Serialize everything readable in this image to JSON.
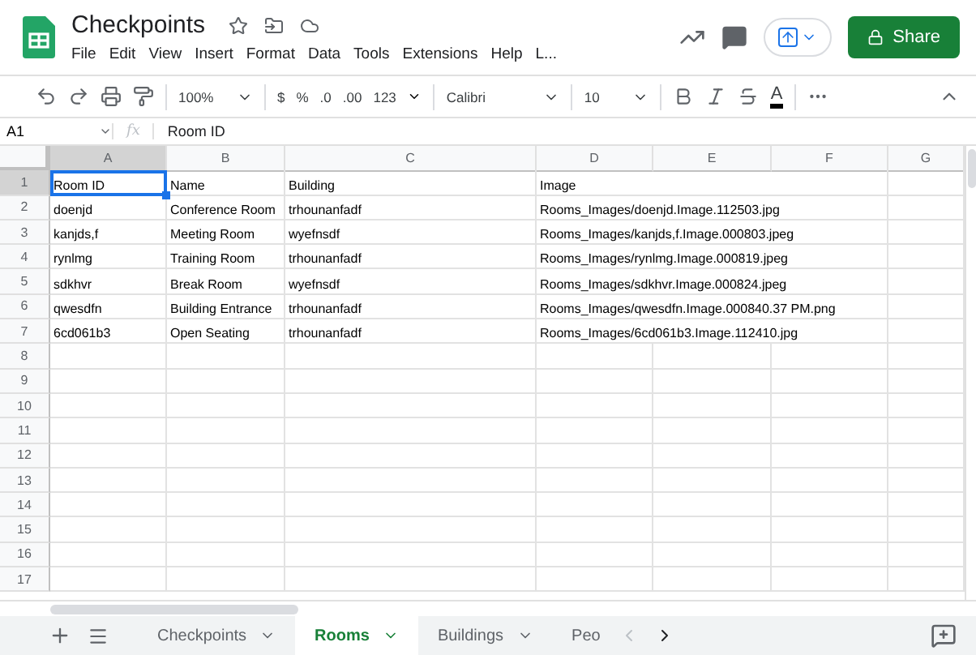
{
  "document": {
    "title": "Checkpoints",
    "starred": false
  },
  "menu": [
    "File",
    "Edit",
    "View",
    "Insert",
    "Format",
    "Data",
    "Tools",
    "Extensions",
    "Help",
    "L..."
  ],
  "share_button": "Share",
  "toolbar": {
    "zoom": "100%",
    "number_formats": [
      "$",
      "%",
      ".0",
      ".00",
      "123"
    ],
    "font": "Calibri",
    "font_size": "10",
    "text_color_label": "A"
  },
  "formula_bar": {
    "name_box": "A1",
    "fx": "fx",
    "value": "Room ID"
  },
  "columns": [
    {
      "label": "A",
      "selected": true
    },
    {
      "label": "B",
      "selected": false
    },
    {
      "label": "C",
      "selected": false
    },
    {
      "label": "D",
      "selected": false
    },
    {
      "label": "E",
      "selected": false
    },
    {
      "label": "F",
      "selected": false
    },
    {
      "label": "G",
      "selected": false
    }
  ],
  "rows": [
    {
      "number": "1",
      "selected": true,
      "cells": [
        {
          "text": "Room ID",
          "selected": true
        },
        {
          "text": "Name",
          "selected": false
        },
        {
          "text": "Building",
          "selected": false
        },
        {
          "text": "Image",
          "selected": false
        }
      ]
    },
    {
      "number": "2",
      "selected": false,
      "cells": [
        {
          "text": "doenjd",
          "selected": false
        },
        {
          "text": "Conference Room",
          "selected": false
        },
        {
          "text": "trhounanfadf",
          "selected": false
        },
        {
          "text": "Rooms_Images/doenjd.Image.112503.jpg",
          "selected": false
        }
      ]
    },
    {
      "number": "3",
      "selected": false,
      "cells": [
        {
          "text": "kanjds,f",
          "selected": false
        },
        {
          "text": "Meeting Room",
          "selected": false
        },
        {
          "text": "wyefnsdf",
          "selected": false
        },
        {
          "text": "Rooms_Images/kanjds,f.Image.000803.jpeg",
          "selected": false
        }
      ]
    },
    {
      "number": "4",
      "selected": false,
      "cells": [
        {
          "text": "rynlmg",
          "selected": false
        },
        {
          "text": "Training Room",
          "selected": false
        },
        {
          "text": "trhounanfadf",
          "selected": false
        },
        {
          "text": "Rooms_Images/rynlmg.Image.000819.jpeg",
          "selected": false
        }
      ]
    },
    {
      "number": "5",
      "selected": false,
      "cells": [
        {
          "text": "sdkhvr",
          "selected": false
        },
        {
          "text": "Break Room",
          "selected": false
        },
        {
          "text": "wyefnsdf",
          "selected": false
        },
        {
          "text": "Rooms_Images/sdkhvr.Image.000824.jpeg",
          "selected": false
        }
      ]
    },
    {
      "number": "6",
      "selected": false,
      "cells": [
        {
          "text": "qwesdfn",
          "selected": false
        },
        {
          "text": "Building Entrance",
          "selected": false
        },
        {
          "text": "trhounanfadf",
          "selected": false
        },
        {
          "text": "Rooms_Images/qwesdfn.Image.000840.37 PM.png",
          "selected": false
        }
      ]
    },
    {
      "number": "7",
      "selected": false,
      "cells": [
        {
          "text": "6cd061b3",
          "selected": false
        },
        {
          "text": "Open Seating",
          "selected": false
        },
        {
          "text": "trhounanfadf",
          "selected": false
        },
        {
          "text": "Rooms_Images/6cd061b3.Image.112410.jpg",
          "selected": false
        }
      ]
    },
    {
      "number": "8",
      "selected": false,
      "cells": []
    },
    {
      "number": "9",
      "selected": false,
      "cells": []
    },
    {
      "number": "10",
      "selected": false,
      "cells": []
    },
    {
      "number": "11",
      "selected": false,
      "cells": []
    },
    {
      "number": "12",
      "selected": false,
      "cells": []
    },
    {
      "number": "13",
      "selected": false,
      "cells": []
    },
    {
      "number": "14",
      "selected": false,
      "cells": []
    },
    {
      "number": "15",
      "selected": false,
      "cells": []
    },
    {
      "number": "16",
      "selected": false,
      "cells": []
    },
    {
      "number": "17",
      "selected": false,
      "cells": []
    }
  ],
  "sheet_tabs": [
    {
      "label": "Checkpoints",
      "selected": false
    },
    {
      "label": "Rooms",
      "selected": true
    },
    {
      "label": "Buildings",
      "selected": false
    },
    {
      "label": "Peo",
      "selected": false
    }
  ]
}
